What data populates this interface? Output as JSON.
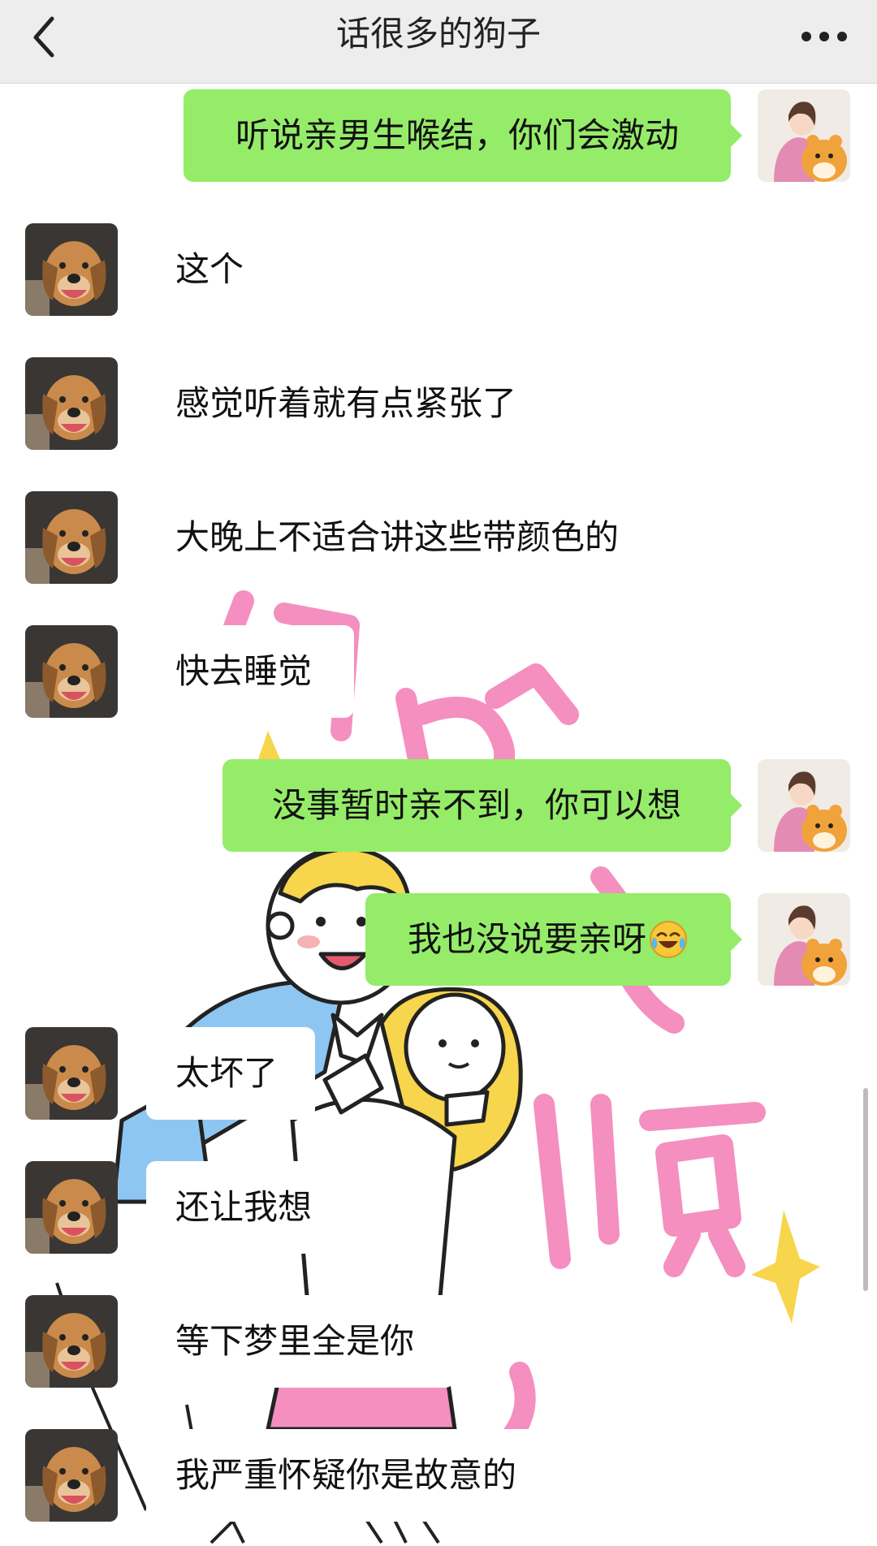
{
  "header": {
    "title": "话很多的狗子"
  },
  "icons": {
    "back": "chevron-left-icon",
    "more": "more-horizontal-icon",
    "emoji": "laughing-crying-emoji-icon"
  },
  "colors": {
    "header_bg": "#ededed",
    "outgoing_bubble": "#95ec69",
    "incoming_bubble": "#ffffff",
    "wallpaper_pink": "#f48fc0",
    "wallpaper_yellow": "#f7d54c",
    "wallpaper_blue": "#8ec6f2"
  },
  "messages": [
    {
      "sender": "me",
      "text": "听说亲男生喉结，你们会激动"
    },
    {
      "sender": "friend",
      "text": "这个"
    },
    {
      "sender": "friend",
      "text": "感觉听着就有点紧张了"
    },
    {
      "sender": "friend",
      "text": "大晚上不适合讲这些带颜色的"
    },
    {
      "sender": "friend",
      "text": "快去睡觉"
    },
    {
      "sender": "me",
      "text": "没事暂时亲不到，你可以想"
    },
    {
      "sender": "me",
      "text": "我也没说要亲呀",
      "emoji": "laughing-crying-emoji"
    },
    {
      "sender": "friend",
      "text": "太坏了"
    },
    {
      "sender": "friend",
      "text": "还让我想"
    },
    {
      "sender": "friend",
      "text": "等下梦里全是你"
    },
    {
      "sender": "friend",
      "text": "我严重怀疑你是故意的"
    }
  ]
}
